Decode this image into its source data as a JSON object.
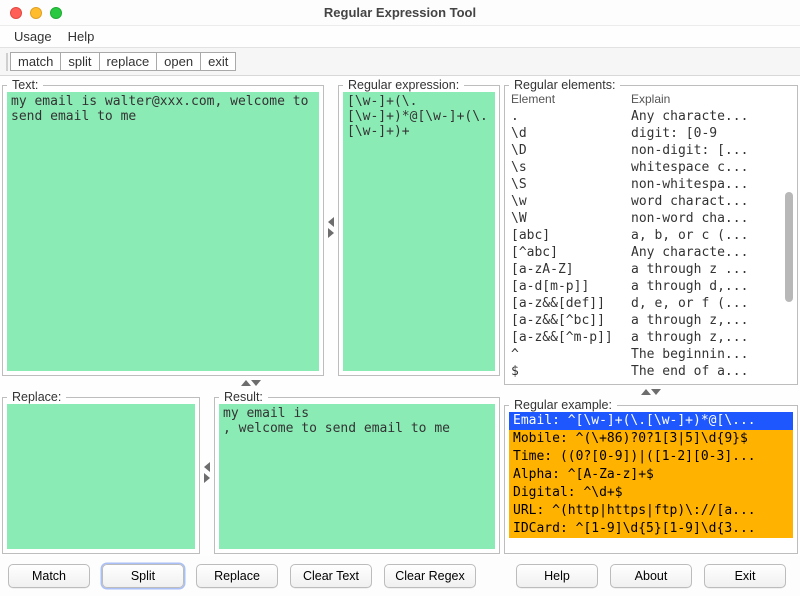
{
  "window": {
    "title": "Regular Expression Tool"
  },
  "menu": {
    "usage": "Usage",
    "help": "Help"
  },
  "toolbar": {
    "match": "match",
    "split": "split",
    "replace": "replace",
    "open": "open",
    "exit": "exit"
  },
  "panels": {
    "text_label": "Text:",
    "regex_label": "Regular expression:",
    "replace_label": "Replace:",
    "result_label": "Result:",
    "elements_label": "Regular elements:",
    "example_label": "Regular example:",
    "text_value": "my email is walter@xxx.com, welcome to send email to me",
    "regex_value": "[\\w-]+(\\.[\\w-]+)*@[\\w-]+(\\.[\\w-]+)+",
    "replace_value": "",
    "result_value": "my email is \n, welcome to send email to me"
  },
  "elements_header": {
    "element": "Element",
    "explain": "Explain"
  },
  "elements": [
    {
      "e": ".",
      "x": "Any characte..."
    },
    {
      "e": "\\d",
      "x": "digit: [0-9"
    },
    {
      "e": "\\D",
      "x": "non-digit: [..."
    },
    {
      "e": "\\s",
      "x": "whitespace c..."
    },
    {
      "e": "\\S",
      "x": "non-whitespa..."
    },
    {
      "e": "\\w",
      "x": "word charact..."
    },
    {
      "e": "\\W",
      "x": "non-word cha..."
    },
    {
      "e": "[abc]",
      "x": "a, b, or c (..."
    },
    {
      "e": "[^abc]",
      "x": "Any characte..."
    },
    {
      "e": "[a-zA-Z]",
      "x": "a through z ..."
    },
    {
      "e": "[a-d[m-p]]",
      "x": "a through d,..."
    },
    {
      "e": "[a-z&&[def]]",
      "x": "d, e, or f (..."
    },
    {
      "e": "[a-z&&[^bc]]",
      "x": "a through z,..."
    },
    {
      "e": "[a-z&&[^m-p]]",
      "x": "a through z,..."
    },
    {
      "e": "^",
      "x": "The beginnin..."
    },
    {
      "e": "$",
      "x": "The end of a..."
    }
  ],
  "examples": [
    {
      "label": "Email: ^[\\w-]+(\\.[\\w-]+)*@[\\...",
      "selected": true
    },
    {
      "label": "Mobile: ^(\\+86)?0?1[3|5]\\d{9}$"
    },
    {
      "label": "Time: ((0?[0-9])|([1-2][0-3]..."
    },
    {
      "label": "Alpha: ^[A-Za-z]+$"
    },
    {
      "label": "Digital: ^\\d+$"
    },
    {
      "label": "URL: ^(http|https|ftp)\\://[a..."
    },
    {
      "label": "IDCard: ^[1-9]\\d{5}[1-9]\\d{3..."
    }
  ],
  "buttons": {
    "match": "Match",
    "split": "Split",
    "replace": "Replace",
    "clear_text": "Clear Text",
    "clear_regex": "Clear Regex",
    "help": "Help",
    "about": "About",
    "exit": "Exit"
  }
}
